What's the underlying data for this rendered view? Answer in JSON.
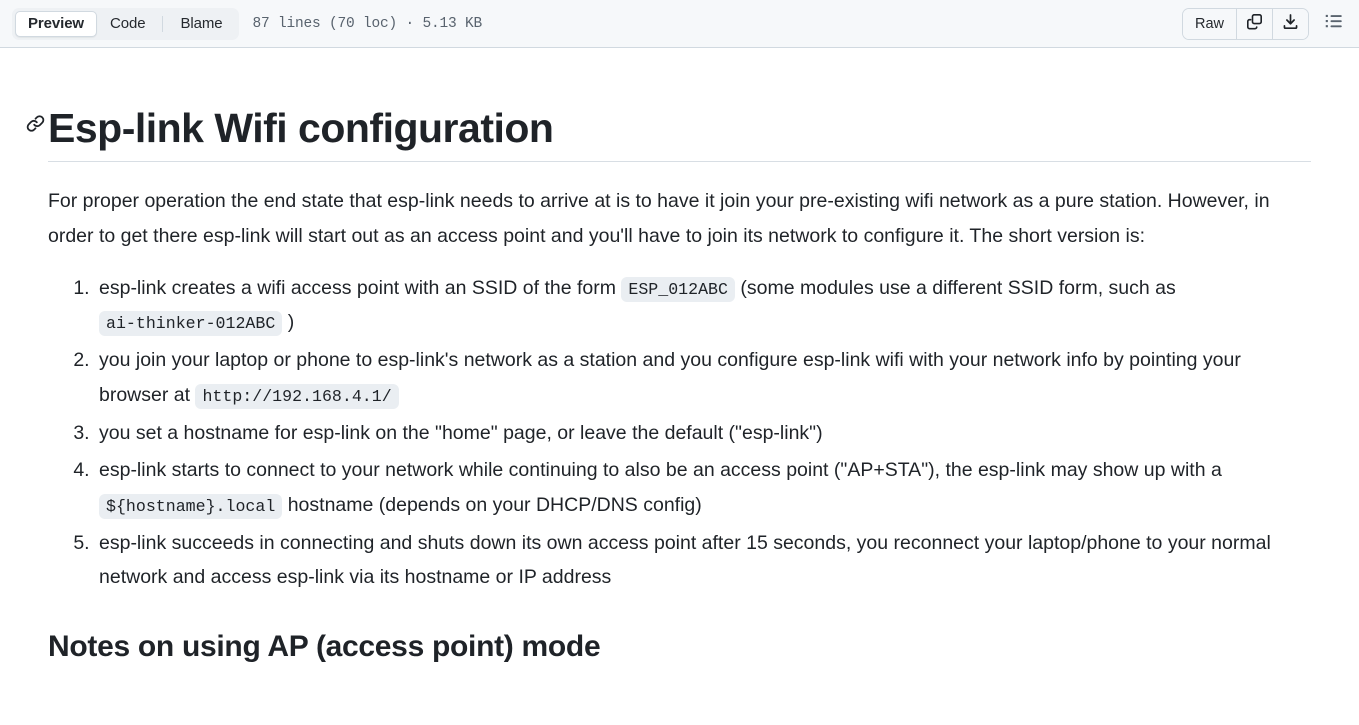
{
  "header": {
    "tabs": [
      {
        "label": "Preview",
        "selected": true
      },
      {
        "label": "Code",
        "selected": false
      },
      {
        "label": "Blame",
        "selected": false
      }
    ],
    "file_meta": "87 lines (70 loc) · 5.13 KB",
    "raw_label": "Raw",
    "icons": {
      "copy": "copy-icon",
      "download": "download-icon",
      "outline": "outline-list-icon"
    },
    "background": "#f6f8fa",
    "border_color": "#d1d9e0"
  },
  "document": {
    "title": "Esp-link Wifi configuration",
    "anchor_icon": "link-icon",
    "intro": "For proper operation the end state that esp-link needs to arrive at is to have it join your pre-existing wifi network as a pure station. However, in order to get there esp-link will start out as an access point and you'll have to join its network to configure it. The short version is:",
    "steps": [
      {
        "parts": [
          {
            "type": "text",
            "value": "esp-link creates a wifi access point with an SSID of the form "
          },
          {
            "type": "code",
            "value": "ESP_012ABC"
          },
          {
            "type": "text",
            "value": " (some modules use a different SSID form, such as "
          },
          {
            "type": "code",
            "value": "ai-thinker-012ABC"
          },
          {
            "type": "text",
            "value": " )"
          }
        ]
      },
      {
        "parts": [
          {
            "type": "text",
            "value": "you join your laptop or phone to esp-link's network as a station and you configure esp-link wifi with your network info by pointing your browser at "
          },
          {
            "type": "code",
            "value": "http://192.168.4.1/"
          }
        ]
      },
      {
        "parts": [
          {
            "type": "text",
            "value": "you set a hostname for esp-link on the \"home\" page, or leave the default (\"esp-link\")"
          }
        ]
      },
      {
        "parts": [
          {
            "type": "text",
            "value": "esp-link starts to connect to your network while continuing to also be an access point (\"AP+STA\"), the esp-link may show up with a "
          },
          {
            "type": "code",
            "value": "${hostname}.local"
          },
          {
            "type": "text",
            "value": " hostname (depends on your DHCP/DNS config)"
          }
        ]
      },
      {
        "parts": [
          {
            "type": "text",
            "value": "esp-link succeeds in connecting and shuts down its own access point after 15 seconds, you reconnect your laptop/phone to your normal network and access esp-link via its hostname or IP address"
          }
        ]
      }
    ],
    "section_heading": "Notes on using AP (access point) mode"
  },
  "colors": {
    "text": "#1f2328",
    "muted": "#59636e",
    "code_bg": "#eaeef2",
    "border": "#d1d9e0"
  }
}
